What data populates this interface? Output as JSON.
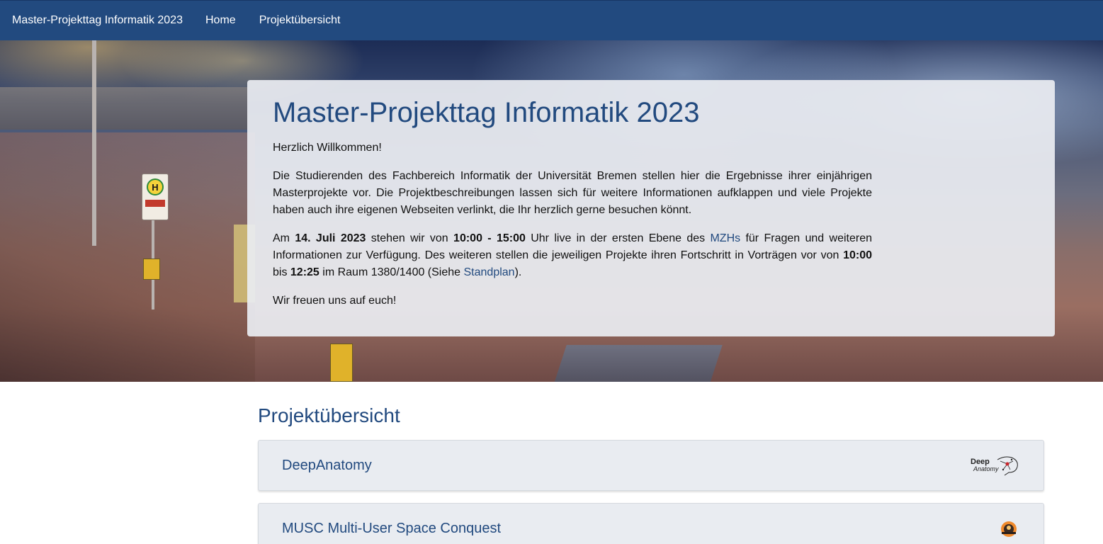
{
  "navbar": {
    "brand": "Master-Projekttag Informatik 2023",
    "links": [
      "Home",
      "Projektübersicht"
    ]
  },
  "hero": {
    "bus_stop_sign": "H"
  },
  "jumbotron": {
    "title": "Master-Projekttag Informatik 2023",
    "greeting": "Herzlich Willkommen!",
    "intro": "Die Studierenden des Fachbereich Informatik der Universität Bremen stellen hier die Ergebnisse ihrer einjährigen Masterprojekte vor. Die Projektbeschreibungen lassen sich für weitere Informationen aufklappen und viele Projekte haben auch ihre eigenen Webseiten verlinkt, die Ihr herzlich gerne besuchen könnt.",
    "schedule": {
      "t1": "Am ",
      "date": "14. Juli 2023",
      "t2": " stehen wir von ",
      "time_range": "10:00 - 15:00",
      "t3": " Uhr live in der ersten Ebene des ",
      "mzh_link": "MZHs",
      "t4": " für Fragen und weiteren Informationen zur Verfügung. Des weiteren stellen die jeweiligen Projekte ihren Fortschritt in Vorträgen vor von ",
      "talk_start": "10:00",
      "t5": " bis ",
      "talk_end": "12:25",
      "t6": " im Raum 1380/1400 (Siehe ",
      "standplan_link": "Standplan",
      "t7": ")."
    },
    "closing": "Wir freuen uns auf euch!"
  },
  "overview": {
    "title": "Projektübersicht",
    "projects": [
      {
        "title": "DeepAnatomy",
        "logo_icon": "deep-anatomy-logo-icon",
        "logo_text_top": "Deep",
        "logo_text_bottom": "Anatomy"
      },
      {
        "title": "MUSC Multi-User Space Conquest",
        "logo_icon": "musc-logo-icon"
      }
    ]
  },
  "colors": {
    "navbar": "#224a7f",
    "heading": "#224a7f",
    "card_bg": "#e9ecf1"
  }
}
